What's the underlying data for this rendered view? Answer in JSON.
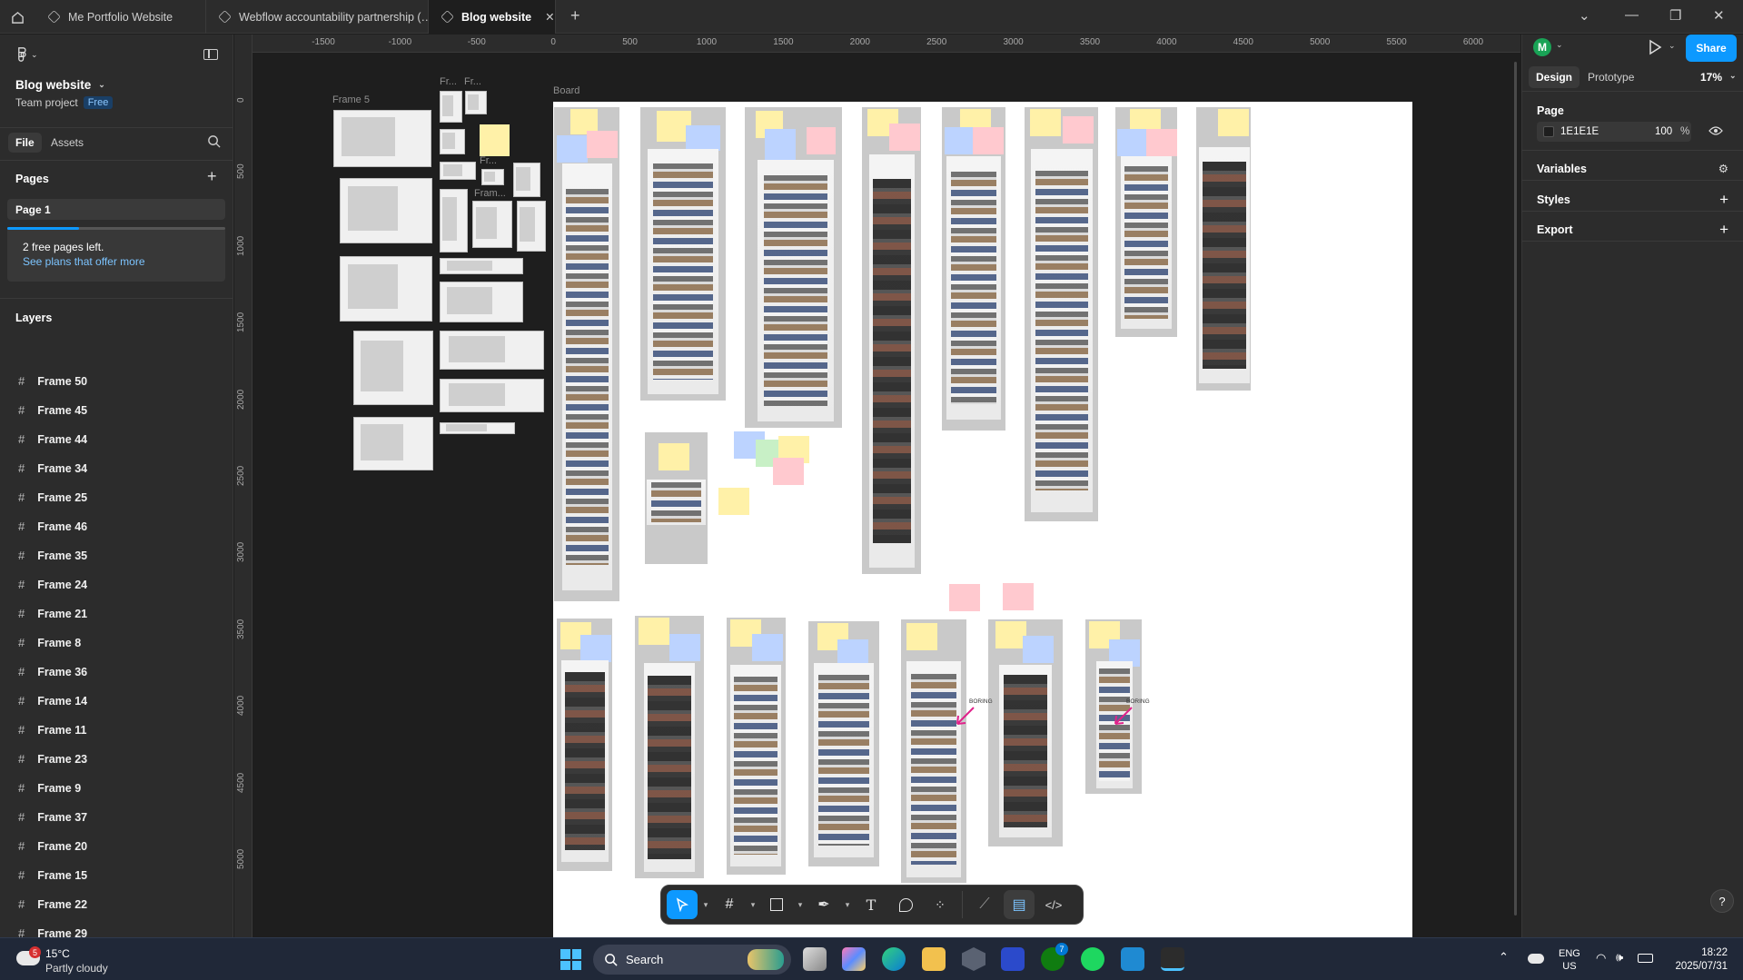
{
  "tabs": [
    {
      "label": "Me Portfolio Website"
    },
    {
      "label": "Webflow accountability partnership (…"
    },
    {
      "label": "Blog website"
    }
  ],
  "new_tab_label": "+",
  "file": {
    "title": "Blog website",
    "project": "Team project",
    "plan_badge": "Free"
  },
  "left_tabs": {
    "file": "File",
    "assets": "Assets"
  },
  "pages": {
    "header": "Pages",
    "items": [
      "Page 1"
    ],
    "notice": "2 free pages left.",
    "notice_link": "See plans that offer more",
    "usage_fraction": 0.33
  },
  "layers": {
    "header": "Layers",
    "items": [
      "Frame 50",
      "Frame 45",
      "Frame 44",
      "Frame 34",
      "Frame 25",
      "Frame 46",
      "Frame 35",
      "Frame 24",
      "Frame 21",
      "Frame 8",
      "Frame 36",
      "Frame 14",
      "Frame 11",
      "Frame 23",
      "Frame 9",
      "Frame 37",
      "Frame 20",
      "Frame 15",
      "Frame 22",
      "Frame 29",
      "Frame 5"
    ]
  },
  "ruler": {
    "top": [
      "-1500",
      "-1000",
      "-500",
      "0",
      "500",
      "1000",
      "1500",
      "2000",
      "2500",
      "3000",
      "3500",
      "4000",
      "4500",
      "5000",
      "5500",
      "6000"
    ],
    "left": [
      "0",
      "500",
      "1000",
      "1500",
      "2000",
      "2500",
      "3000",
      "3500",
      "4000",
      "4500",
      "5000"
    ]
  },
  "canvas": {
    "board_label": "Board",
    "frame5_label": "Frame 5",
    "frame_short_labels": [
      "Fr...",
      "Fr...",
      "Fr...",
      "Fram..."
    ],
    "annotation_boring": "BORING"
  },
  "right_panel": {
    "avatar_initial": "M",
    "share": "Share",
    "tabs": {
      "design": "Design",
      "prototype": "Prototype"
    },
    "zoom": "17%",
    "page_section": "Page",
    "page_color": "1E1E1E",
    "page_opacity": "100",
    "page_opacity_unit": "%",
    "sections": [
      "Variables",
      "Styles",
      "Export"
    ],
    "help": "?"
  },
  "taskbar": {
    "weather_temp": "15°C",
    "weather_desc": "Partly cloudy",
    "weather_badge": "5",
    "search": "Search",
    "xbox_badge": "7",
    "lang_top": "ENG",
    "lang_bottom": "US",
    "time": "18:22",
    "date": "2025/07/31"
  },
  "colors": {
    "accent": "#0d99ff",
    "canvas_bg": "#1E1E1E",
    "panel_bg": "#2c2c2c",
    "annotation": "#e0218a"
  }
}
